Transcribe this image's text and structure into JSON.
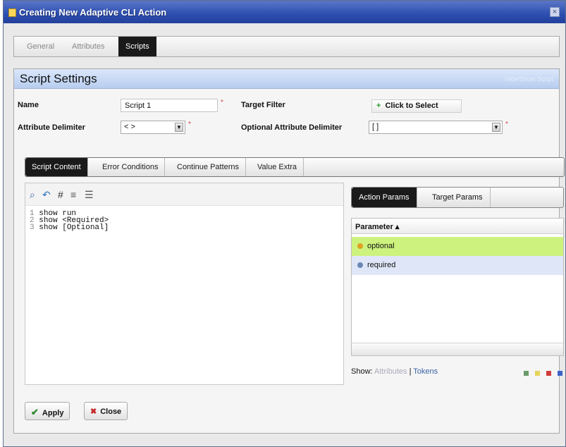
{
  "window": {
    "title": "Creating New Adaptive CLI Action",
    "close_symbol": "×"
  },
  "main_tabs": [
    {
      "label": "General"
    },
    {
      "label": "Attributes"
    },
    {
      "label": "Scripts"
    }
  ],
  "panel": {
    "title": "Script Settings",
    "header_link": "Hide/Show Script"
  },
  "form": {
    "name_label": "Name",
    "name_value": "Script 1",
    "target_filter_label": "Target Filter",
    "click_to_select": "Click to Select",
    "attr_delim_label": "Attribute Delimiter",
    "attr_delim_value": "< >",
    "opt_attr_delim_label": "Optional Attribute Delimiter",
    "opt_attr_delim_value": "[ ]",
    "required_marker": "*"
  },
  "sub_tabs": [
    {
      "label": "Script Content"
    },
    {
      "label": "Error Conditions"
    },
    {
      "label": "Continue Patterns"
    },
    {
      "label": "Value Extra"
    }
  ],
  "editor": {
    "lines": [
      {
        "num": "1",
        "text": "show run"
      },
      {
        "num": "2",
        "text": "show <Required>"
      },
      {
        "num": "3",
        "text": "show [Optional]"
      }
    ]
  },
  "param_tabs": [
    {
      "label": "Action Params"
    },
    {
      "label": "Target Params"
    }
  ],
  "params_grid": {
    "header": "Parameter ▴",
    "rows": [
      {
        "name": "optional",
        "color": "#e0a020"
      },
      {
        "name": "required",
        "color": "#6b87b5"
      }
    ]
  },
  "show_bar": {
    "label": "Show:",
    "attributes": "Attributes",
    "separator": "|",
    "tokens": "Tokens",
    "legend_colors": [
      "#6a9a6a",
      "#e6d35a",
      "#d33a3a",
      "#3a63c8"
    ]
  },
  "buttons": {
    "apply": "Apply",
    "close": "Close"
  }
}
